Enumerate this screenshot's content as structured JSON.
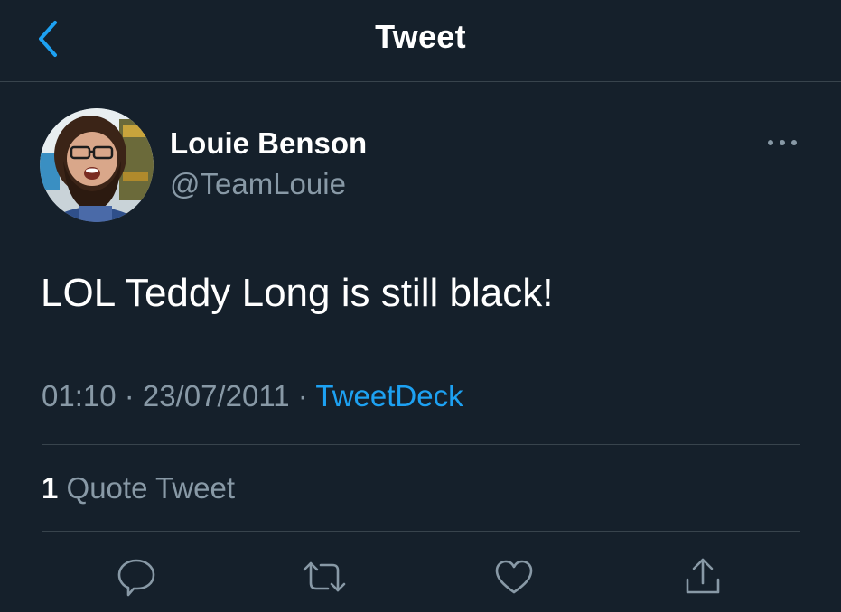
{
  "header": {
    "title": "Tweet",
    "back_icon": "chevron-left-icon"
  },
  "author": {
    "name": "Louie Benson",
    "handle": "@TeamLouie"
  },
  "tweet": {
    "text": "LOL Teddy Long is still black!",
    "time": "01:10",
    "separator": " · ",
    "date": "23/07/2011",
    "source": "TweetDeck"
  },
  "stats": {
    "quote_count": "1",
    "quote_label": " Quote Tweet"
  },
  "actions": [
    {
      "name": "reply",
      "icon": "reply-icon"
    },
    {
      "name": "retweet",
      "icon": "retweet-icon"
    },
    {
      "name": "like",
      "icon": "heart-icon"
    },
    {
      "name": "share",
      "icon": "share-icon"
    }
  ],
  "colors": {
    "background": "#15202b",
    "accent": "#1da1f2",
    "secondary_text": "#8899a6",
    "divider": "#38444d"
  }
}
